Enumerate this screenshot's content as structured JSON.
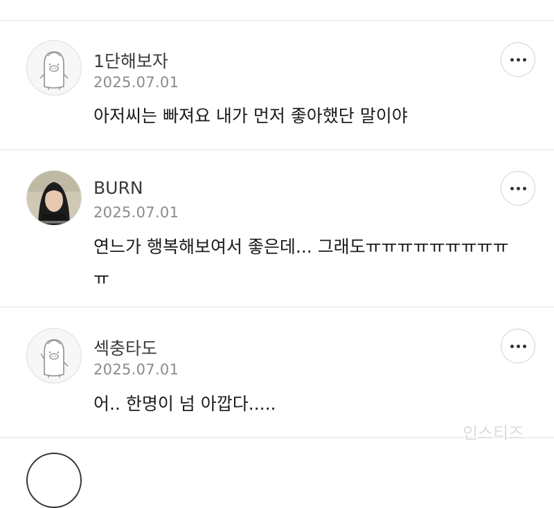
{
  "comments": [
    {
      "author": "1단해보자",
      "date": "2025.07.01",
      "text": "아저씨는 빠져요 내가 먼저 좋아했단 말이야",
      "avatar": "default-character-icon"
    },
    {
      "author": "BURN",
      "date": "2025.07.01",
      "text": "연느가 행복해보여서 좋은데... 그래도ㅠㅠㅠㅠㅠㅠㅠㅠㅠㅠ",
      "avatar": "profile-photo"
    },
    {
      "author": "섹충타도",
      "date": "2025.07.01",
      "text": "어.. 한명이 넘 아깝다.....",
      "avatar": "default-character-waving-icon"
    }
  ],
  "more_icon": "more-horizontal-icon",
  "watermark": "인스티즈",
  "colors": {
    "divider": "#e4e4e4",
    "author": "#3a3a3a",
    "date": "#8a8a8a",
    "text": "#1a1a1a"
  }
}
